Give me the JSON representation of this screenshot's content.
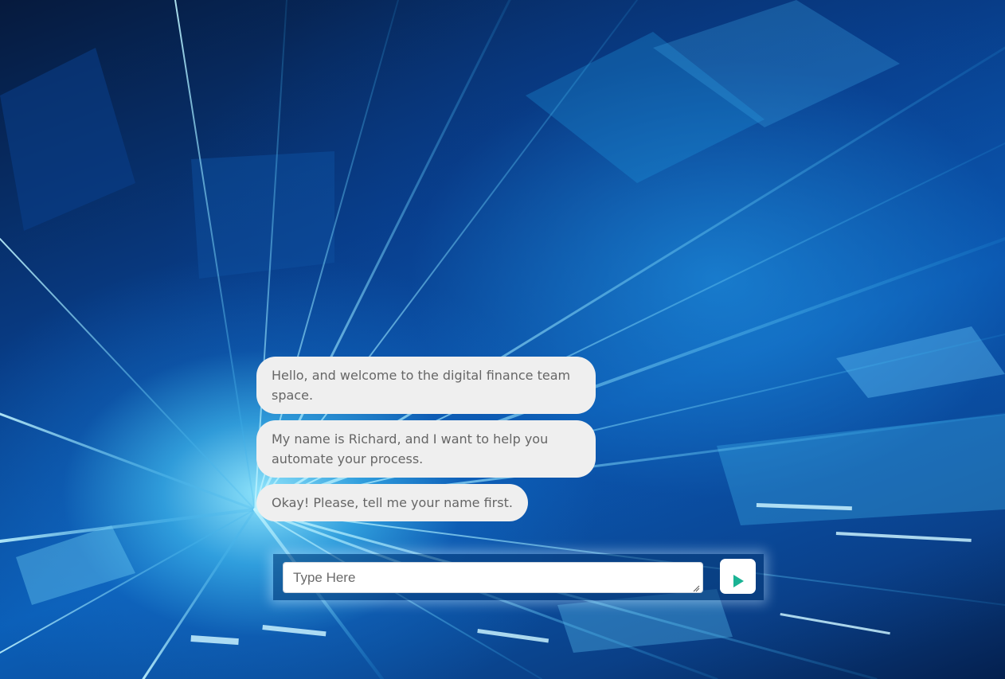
{
  "chat": {
    "messages": [
      "Hello, and welcome to the digital finance team space.",
      "My name is Richard, and I want to help you automate your process.",
      "Okay! Please, tell me your name first."
    ]
  },
  "composer": {
    "placeholder": "Type Here",
    "value": "",
    "send_icon": "play-triangle-icon",
    "send_icon_color": "#1ab394"
  },
  "colors": {
    "bubble_background": "#efefef",
    "bubble_text": "#666666"
  }
}
